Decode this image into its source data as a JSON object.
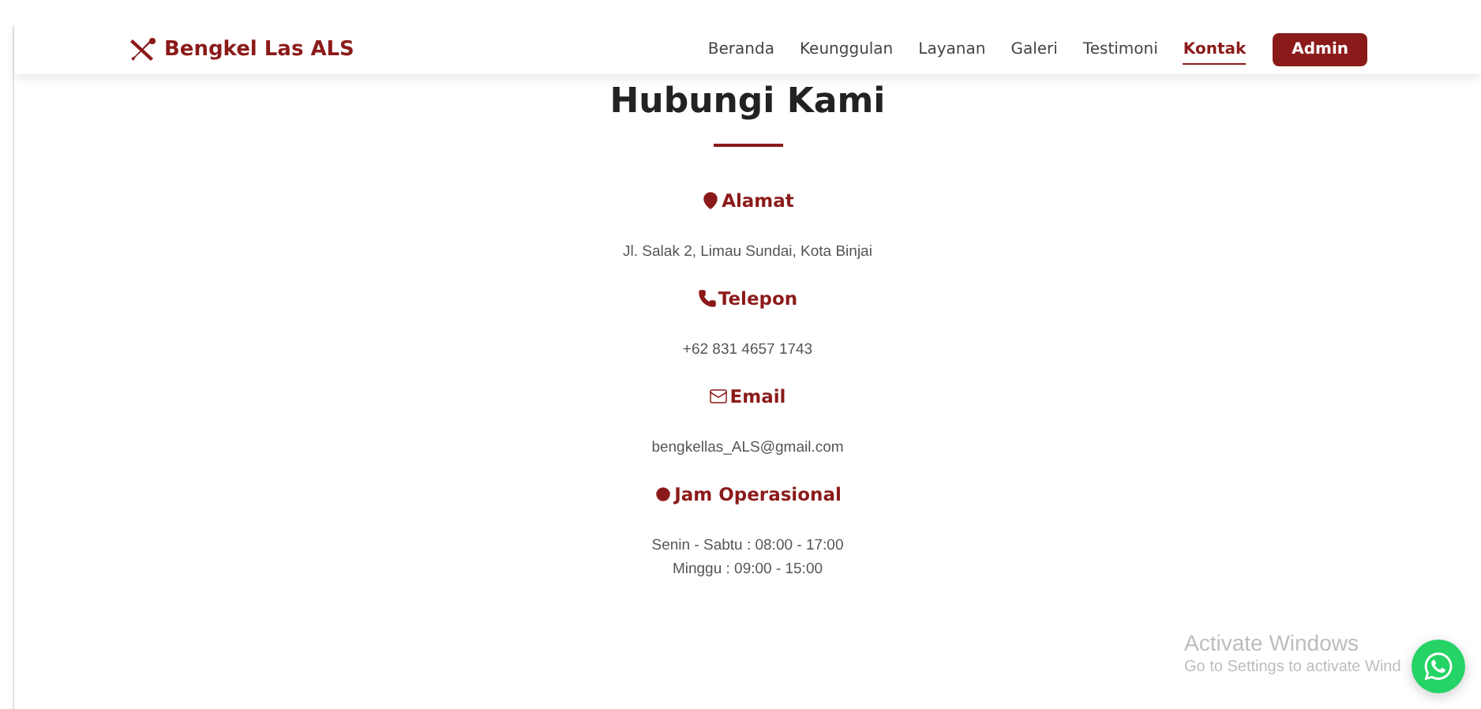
{
  "brand": {
    "name": "Bengkel Las ALS"
  },
  "nav": {
    "links": [
      {
        "label": "Beranda",
        "selected": false
      },
      {
        "label": "Keunggulan",
        "selected": false
      },
      {
        "label": "Layanan",
        "selected": false
      },
      {
        "label": "Galeri",
        "selected": false
      },
      {
        "label": "Testimoni",
        "selected": false
      },
      {
        "label": "Kontak",
        "selected": true
      }
    ],
    "button": "Admin"
  },
  "heading": "Hubungi Kami",
  "sections": [
    {
      "title": "Alamat",
      "lines": [
        "Jl. Salak 2, Limau Sundai, Kota Binjai"
      ]
    },
    {
      "title": "Telepon",
      "lines": [
        "+62 831 4657 1743"
      ]
    },
    {
      "title": "Email",
      "lines": [
        "bengkellas_ALS@gmail.com"
      ]
    },
    {
      "title": "Jam Operasional",
      "lines": [
        "Senin - Sabtu : 08:00 - 17:00",
        "Minggu : 09:00 - 15:00"
      ]
    }
  ],
  "os_notice": {
    "title": "Activate Windows",
    "text": "Go to Settings to activate Wind"
  }
}
